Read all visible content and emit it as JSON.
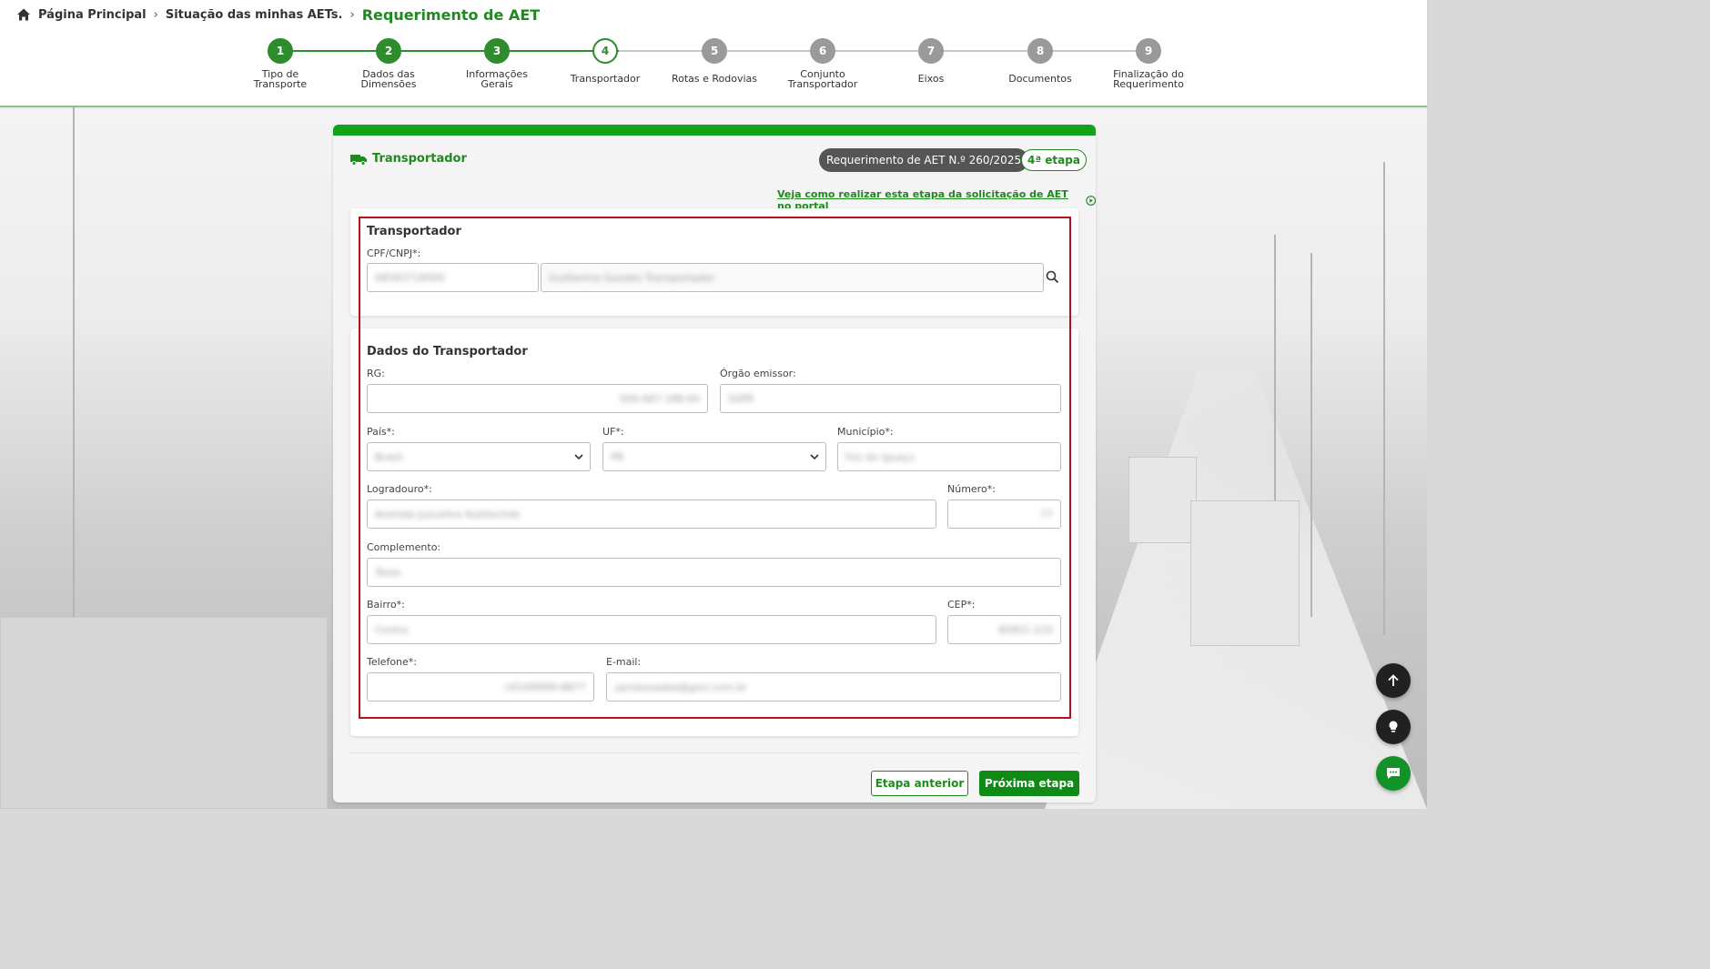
{
  "breadcrumb": {
    "home": "Página Principal",
    "list": "Situação das minhas AETs.",
    "current": "Requerimento de AET"
  },
  "stepper": [
    {
      "num": "1",
      "label1": "Tipo de",
      "label2": "Transporte",
      "state": "done"
    },
    {
      "num": "2",
      "label1": "Dados das",
      "label2": "Dimensões",
      "state": "done"
    },
    {
      "num": "3",
      "label1": "Informações",
      "label2": "Gerais",
      "state": "done"
    },
    {
      "num": "4",
      "label1": "Transportador",
      "label2": "",
      "state": "active"
    },
    {
      "num": "5",
      "label1": "Rotas e Rodovias",
      "label2": "",
      "state": "todo"
    },
    {
      "num": "6",
      "label1": "Conjunto",
      "label2": "Transportador",
      "state": "todo"
    },
    {
      "num": "7",
      "label1": "Eixos",
      "label2": "",
      "state": "todo"
    },
    {
      "num": "8",
      "label1": "Documentos",
      "label2": "",
      "state": "todo"
    },
    {
      "num": "9",
      "label1": "Finalização do",
      "label2": "Requerimento",
      "state": "todo"
    }
  ],
  "card": {
    "title": "Transportador",
    "request_badge": "Requerimento de AET N.º 260/2025",
    "stage_badge": "4ª etapa",
    "help_link": "Veja como realizar esta etapa da solicitação de AET no portal"
  },
  "transportador": {
    "heading": "Transportador",
    "cpf_label": "CPF/CNPJ*:",
    "cpf_value": "08583718000",
    "name_value": "Guilherme Guedes Transportador"
  },
  "dados": {
    "heading": "Dados do Transportador",
    "rg_label": "RG:",
    "rg_value": "000.687.188-00",
    "orgao_label": "Órgão emissor:",
    "orgao_value": "SSPR",
    "pais_label": "País*:",
    "pais_value": "Brasil",
    "uf_label": "UF*:",
    "uf_value": "PR",
    "municipio_label": "Município*:",
    "municipio_value": "Foz do Iguaçu",
    "logradouro_label": "Logradouro*:",
    "logradouro_value": "Avenida Juscelino Kubitschek",
    "numero_label": "Número*:",
    "numero_value": "77",
    "complemento_label": "Complemento:",
    "complemento_value": "Teste",
    "bairro_label": "Bairro*:",
    "bairro_value": "Centro",
    "cep_label": "CEP*:",
    "cep_value": "85851-210",
    "telefone_label": "Telefone*:",
    "telefone_value": "(45)99999-8877",
    "email_label": "E-mail:",
    "email_value": "upnlaseaaba@gesi.com.br"
  },
  "actions": {
    "prev": "Etapa anterior",
    "next": "Próxima etapa"
  },
  "colors": {
    "brand_green": "#1e8a1e",
    "card_top": "#16a11b",
    "highlight_red": "#b3121d"
  },
  "icons": [
    "home-icon",
    "chevron-right-icon",
    "truck-icon",
    "play-circle-icon",
    "search-icon",
    "chevron-down-icon",
    "arrow-up-icon",
    "lightbulb-icon",
    "chat-icon"
  ]
}
